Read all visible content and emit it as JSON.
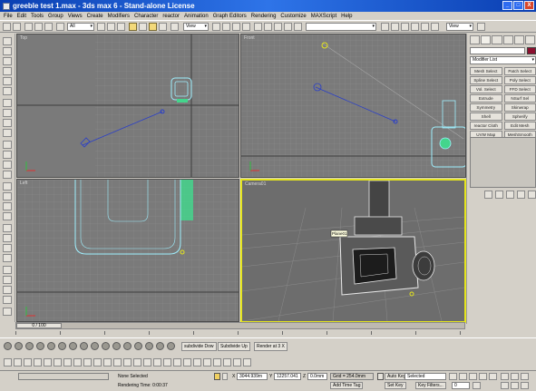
{
  "window": {
    "title": "greeble test 1.max - 3ds max 6 - Stand-alone License",
    "controls": [
      "_",
      "□",
      "X"
    ]
  },
  "menu": [
    "File",
    "Edit",
    "Tools",
    "Group",
    "Views",
    "Create",
    "Modifiers",
    "Character",
    "reactor",
    "Animation",
    "Graph Editors",
    "Rendering",
    "Customize",
    "MAXScript",
    "Help"
  ],
  "toolbar": {
    "selection_filter": "All",
    "ref_coord": "View",
    "named_selection": "",
    "view_dropdown_right": "View"
  },
  "viewports": {
    "top": {
      "label": "Top"
    },
    "front": {
      "label": "Front"
    },
    "left": {
      "label": "Left"
    },
    "camera": {
      "label": "Camera01",
      "object_tag": "Plane01"
    }
  },
  "command_panel": {
    "modifier_list": "Modifier List",
    "modifier_buttons": [
      "Mesh Select",
      "Patch Select",
      "Spline Select",
      "Poly Select",
      "Vol. Select",
      "FFD Select",
      "Extrude",
      "NSurf Sel",
      "Symmetry",
      "Skinwrap",
      "Shell",
      "Spherify",
      "reactor Cloth",
      "Edit Mesh",
      "UVW Map",
      "MeshSmooth"
    ],
    "object_color": "#8b0f2e"
  },
  "timeline": {
    "frame_display": "0 / 100",
    "ticks": [
      "0",
      "10",
      "20",
      "30",
      "40",
      "50",
      "60",
      "70",
      "80",
      "90",
      "100"
    ]
  },
  "tab_panel": {
    "items": [
      "subdivide Dow",
      "Subdivide Up",
      "Render at 3 X"
    ]
  },
  "status": {
    "selection": "None Selected",
    "prompt": "Rendering Time: 0:00:37",
    "x_label": "X",
    "x_value": "3044.939m",
    "y_label": "Y",
    "y_value": "12257.041",
    "z_label": "Z",
    "z_value": "0.0mm",
    "grid": "Grid = 254.0mm",
    "add_time_tag": "Add Time Tag",
    "auto_key": "Auto Key",
    "set_key": "Set Key",
    "key_filter_dropdown": "Selected",
    "key_filters": "Key Filters...",
    "current_frame": "0"
  }
}
